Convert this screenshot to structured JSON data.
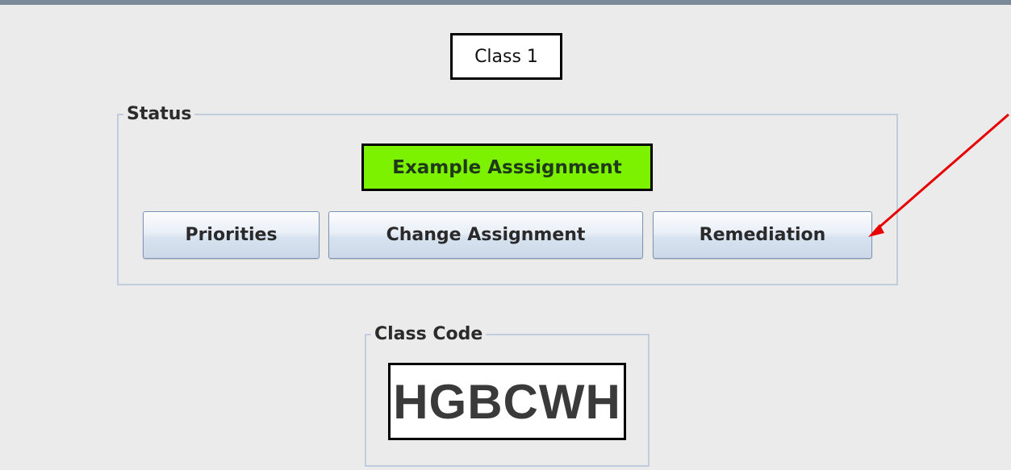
{
  "class_title": "Class 1",
  "status": {
    "title": "Status",
    "assignment": "Example Asssignment",
    "buttons": {
      "priorities": "Priorities",
      "change_assignment": "Change Assignment",
      "remediation": "Remediation"
    }
  },
  "class_code": {
    "title": "Class Code",
    "value": "HGBCWH"
  },
  "annotation": {
    "arrow_color": "#e60000",
    "target": "remediation-button"
  },
  "colors": {
    "assignment_background": "#7cf200",
    "window_background": "#ebebeb"
  }
}
